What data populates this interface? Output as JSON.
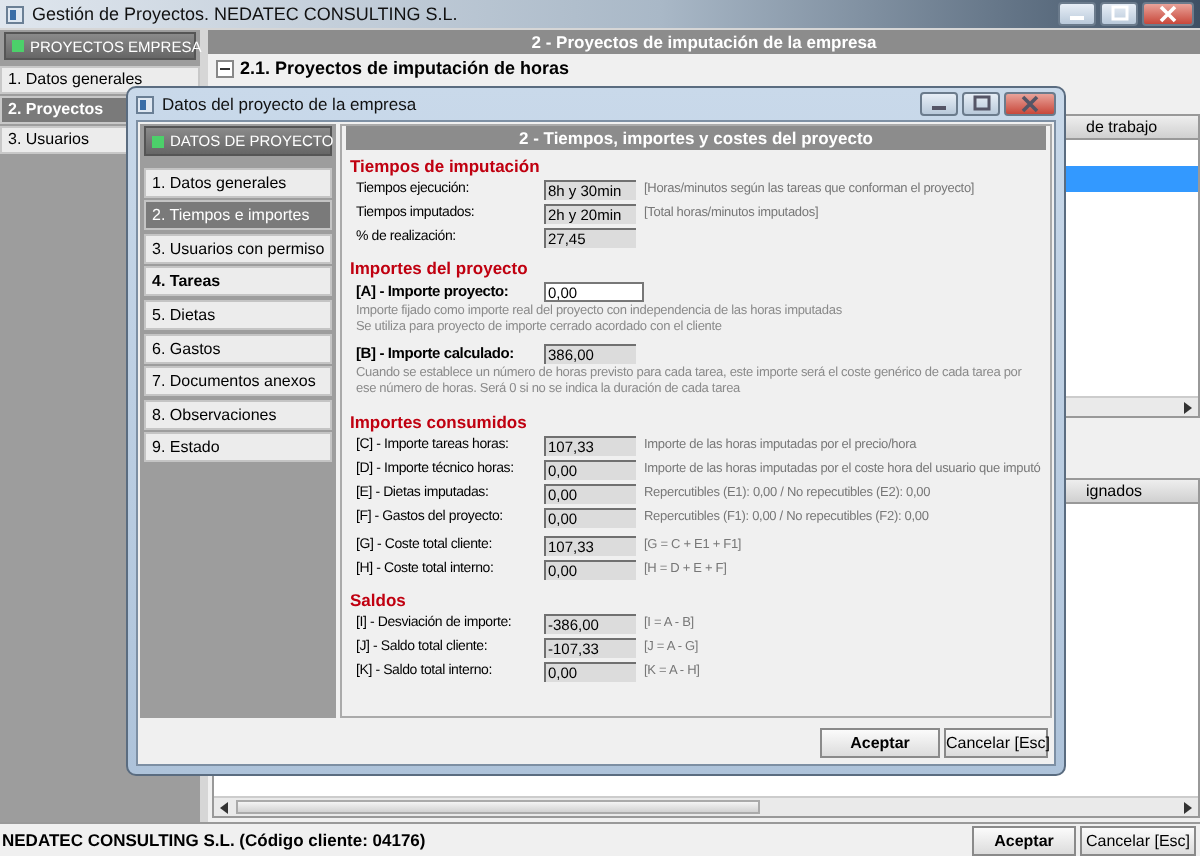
{
  "window": {
    "title": "Gestión de Proyectos. NEDATEC CONSULTING S.L."
  },
  "sidebar": {
    "header": "PROYECTOS EMPRESA",
    "items": [
      {
        "label": "1. Datos generales",
        "selected": false
      },
      {
        "label": "2. Proyectos",
        "selected": true
      },
      {
        "label": "3. Usuarios",
        "selected": false
      }
    ]
  },
  "main": {
    "header": "2 - Proyectos de imputación de la empresa",
    "section": {
      "title": "2.1. Proyectos de imputación de horas",
      "expanded": true
    },
    "table": {
      "column_1": "de trabajo",
      "rows": [
        {
          "selected": false
        },
        {
          "selected": true
        }
      ]
    },
    "table_2": {
      "column_1": "ignados"
    }
  },
  "dialog": {
    "title": "Datos del proyecto de la empresa",
    "nav": {
      "header": "DATOS DE PROYECTO",
      "items": [
        {
          "label": "1. Datos generales",
          "selected": false,
          "bold": false
        },
        {
          "label": "2. Tiempos e importes",
          "selected": true,
          "bold": false
        },
        {
          "label": "3. Usuarios con permiso",
          "selected": false,
          "bold": false
        },
        {
          "label": "4. Tareas",
          "selected": false,
          "bold": true
        },
        {
          "label": "5. Dietas",
          "selected": false,
          "bold": false
        },
        {
          "label": "6. Gastos",
          "selected": false,
          "bold": false
        },
        {
          "label": "7. Documentos anexos",
          "selected": false,
          "bold": false
        },
        {
          "label": "8. Observaciones",
          "selected": false,
          "bold": false
        },
        {
          "label": "9. Estado",
          "selected": false,
          "bold": false
        }
      ]
    },
    "panel": {
      "header": "2 - Tiempos, importes y costes del proyecto",
      "sections": [
        {
          "title": "Tiempos de imputación",
          "groups": [
            [
              {
                "kind": "field",
                "emphasized": false,
                "label": "Tiempos ejecución:",
                "value": "8h y 30min",
                "note": "[Horas/minutos según las tareas que conforman el proyecto]"
              },
              {
                "kind": "field",
                "emphasized": false,
                "label": "Tiempos imputados:",
                "value": "2h y 20min",
                "note": "[Total horas/minutos imputados]"
              },
              {
                "kind": "field",
                "emphasized": false,
                "label": "% de realización:",
                "value": "27,45"
              }
            ]
          ]
        },
        {
          "title": "Importes del proyecto",
          "groups": [
            [
              {
                "kind": "input",
                "emphasized": true,
                "label": "[A] - Importe proyecto:",
                "value": "0,00"
              },
              {
                "kind": "help",
                "lines": [
                  "Importe fijado como importe real del proyecto con independencia de las horas imputadas",
                  "Se utiliza para proyecto de importe cerrado acordado con el cliente"
                ]
              },
              {
                "kind": "field",
                "emphasized": true,
                "label": "[B] - Importe calculado:",
                "value": "386,00"
              },
              {
                "kind": "help",
                "lines": [
                  "Cuando se establece un número de horas previsto para cada tarea, este importe será el coste genérico de cada tarea por",
                  "ese número de horas. Será 0 si no se indica la duración de cada tarea"
                ]
              }
            ]
          ]
        },
        {
          "title": "Importes consumidos",
          "groups": [
            [
              {
                "kind": "field",
                "emphasized": false,
                "label": "[C] - Importe tareas horas:",
                "value": "107,33",
                "note": "Importe de las horas imputadas por el precio/hora"
              },
              {
                "kind": "field",
                "emphasized": false,
                "label": "[D] - Importe técnico horas:",
                "value": "0,00",
                "note": "Importe de las horas imputadas por el coste hora del usuario que imputó"
              },
              {
                "kind": "field",
                "emphasized": false,
                "label": "[E] - Dietas imputadas:",
                "value": "0,00",
                "note": "Repercutibles (E1): 0,00 / No repecutibles (E2): 0,00"
              },
              {
                "kind": "field",
                "emphasized": false,
                "label": "[F] - Gastos del proyecto:",
                "value": "0,00",
                "note": "Repercutibles (F1): 0,00 / No repecutibles (F2): 0,00"
              }
            ],
            [
              {
                "kind": "field",
                "emphasized": false,
                "label": "[G] - Coste total cliente:",
                "value": "107,33",
                "note": "[G = C + E1 + F1]"
              },
              {
                "kind": "field",
                "emphasized": false,
                "label": "[H] - Coste total interno:",
                "value": "0,00",
                "note": "[H = D + E + F]"
              }
            ]
          ]
        },
        {
          "title": "Saldos",
          "groups": [
            [
              {
                "kind": "field",
                "emphasized": false,
                "label": "[I] - Desviación de importe:",
                "value": "-386,00",
                "note": "[I = A - B]"
              },
              {
                "kind": "field",
                "emphasized": false,
                "label": "[J] - Saldo total cliente:",
                "value": "-107,33",
                "note": "[J = A - G]"
              },
              {
                "kind": "field",
                "emphasized": false,
                "label": "[K] - Saldo total interno:",
                "value": "0,00",
                "note": "[K = A - H]"
              }
            ]
          ]
        }
      ]
    },
    "buttons": [
      "Aceptar",
      "Cancelar [Esc]"
    ]
  },
  "status_bar": {
    "text": "NEDATEC CONSULTING S.L. (Código cliente: 04176)",
    "buttons": [
      "Aceptar",
      "Cancelar [Esc]"
    ]
  }
}
